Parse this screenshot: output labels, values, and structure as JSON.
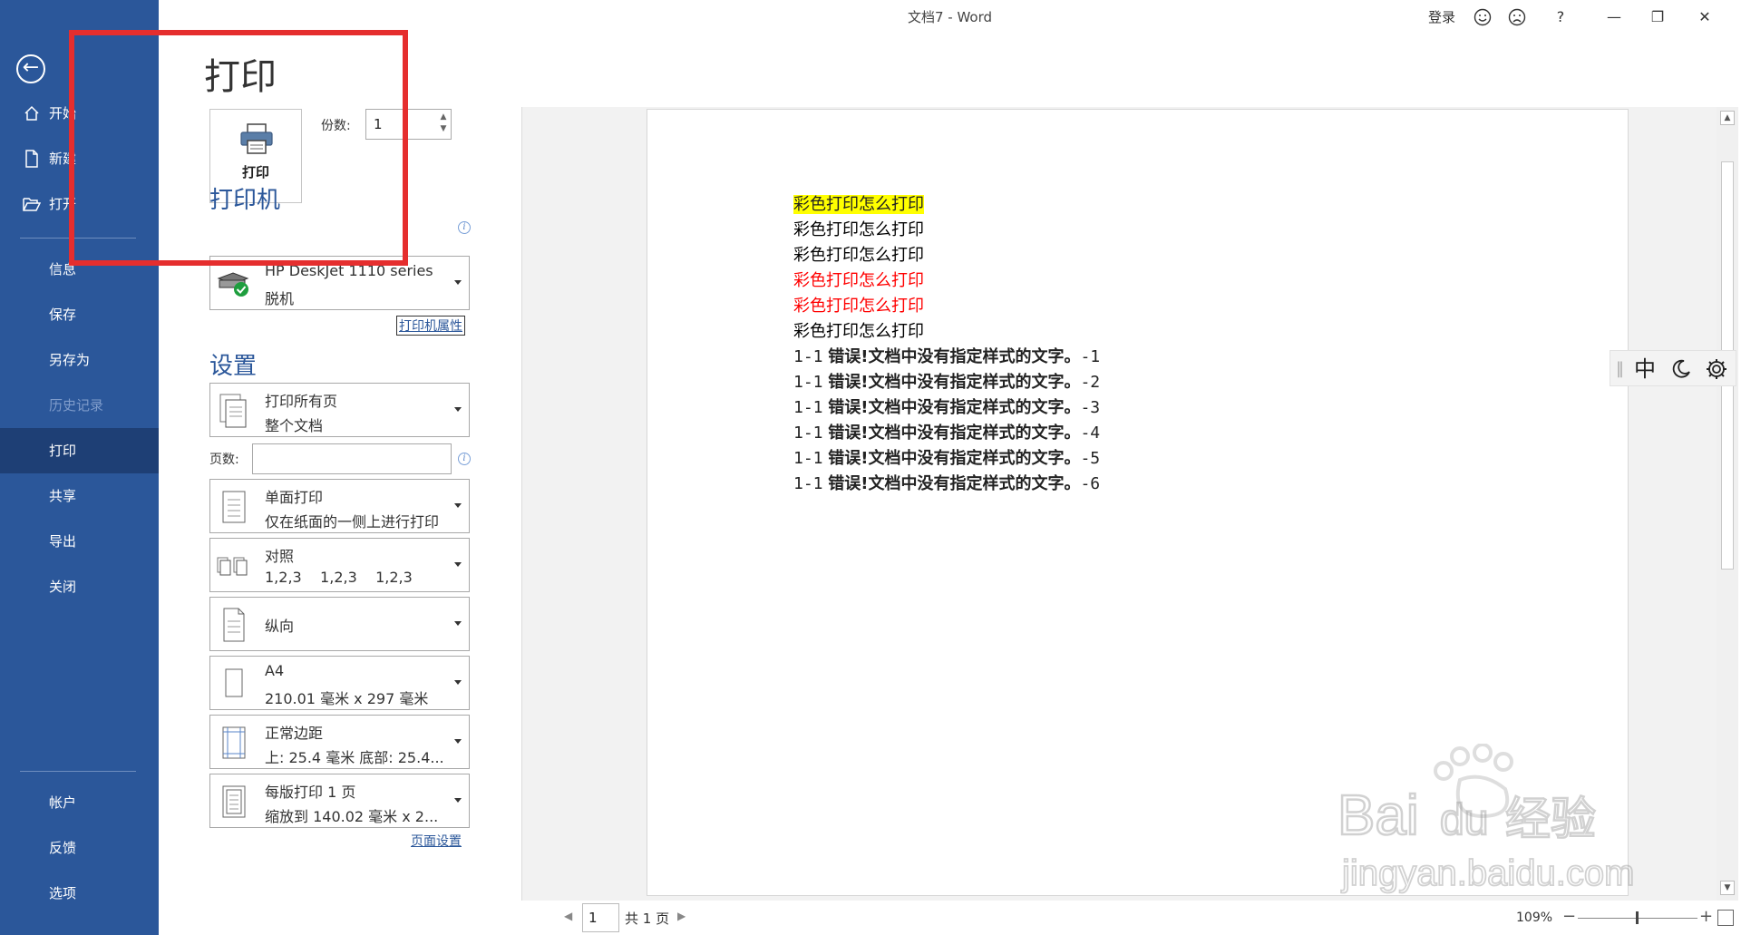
{
  "window": {
    "title": "文档7 - Word",
    "signin_label": "登录",
    "smile_icon": "smile-feedback-icon",
    "frown_icon": "frown-feedback-icon",
    "help_label": "?",
    "minimize": "—",
    "restore": "❐",
    "close": "✕"
  },
  "nav": {
    "back_icon": "←",
    "items": [
      {
        "label": "开始",
        "icon": "home-icon"
      },
      {
        "label": "新建",
        "icon": "new-document-icon"
      },
      {
        "label": "打开",
        "icon": "open-folder-icon"
      },
      {
        "label": "信息"
      },
      {
        "label": "保存"
      },
      {
        "label": "另存为"
      },
      {
        "label": "历史记录",
        "disabled": true
      },
      {
        "label": "打印",
        "active": true
      },
      {
        "label": "共享"
      },
      {
        "label": "导出"
      },
      {
        "label": "关闭"
      }
    ],
    "bottom_items": [
      {
        "label": "帐户"
      },
      {
        "label": "反馈"
      },
      {
        "label": "选项"
      }
    ]
  },
  "print": {
    "page_title": "打印",
    "print_button_label": "打印",
    "copies_label": "份数:",
    "copies_value": "1",
    "printer_section": "打印机",
    "printer_name": "HP DeskJet 1110 series",
    "printer_status": "脱机",
    "printer_properties_link": "打印机属性",
    "settings_section": "设置",
    "pages_label": "页数:",
    "pages_value": "",
    "page_setup_link": "页面设置",
    "settings": [
      {
        "line1": "打印所有页",
        "line2": "整个文档",
        "icon": "pages-icon"
      },
      {
        "line1": "单面打印",
        "line2": "仅在纸面的一侧上进行打印",
        "icon": "single-sided-icon"
      },
      {
        "line1": "对照",
        "line2": "1,2,3    1,2,3    1,2,3",
        "icon": "collate-icon"
      },
      {
        "line1": "纵向",
        "line2": "",
        "icon": "portrait-icon"
      },
      {
        "line1": "A4",
        "line2": "210.01 毫米 x 297 毫米",
        "icon": "paper-size-icon"
      },
      {
        "line1": "正常边距",
        "line2": "上: 25.4 毫米 底部: 25.4...",
        "icon": "margins-icon"
      },
      {
        "line1": "每版打印 1 页",
        "line2": "缩放到 140.02 毫米 x 2...",
        "icon": "pages-per-sheet-icon"
      }
    ]
  },
  "document": {
    "lines": [
      {
        "text": "彩色打印怎么打印",
        "color": "#000000",
        "highlight": "#ffff00"
      },
      {
        "text": "彩色打印怎么打印",
        "color": "#000000"
      },
      {
        "text": "彩色打印怎么打印",
        "color": "#000000"
      },
      {
        "text": "彩色打印怎么打印",
        "color": "#ff0000"
      },
      {
        "text": "彩色打印怎么打印",
        "color": "#ff0000"
      },
      {
        "text": "彩色打印怎么打印",
        "color": "#000000"
      }
    ],
    "errors": [
      {
        "num": "1-1",
        "text": "错误!文档中没有指定样式的文字。",
        "suffix": "-1"
      },
      {
        "num": "1-1",
        "text": "错误!文档中没有指定样式的文字。",
        "suffix": "-2"
      },
      {
        "num": "1-1",
        "text": "错误!文档中没有指定样式的文字。",
        "suffix": "-3"
      },
      {
        "num": "1-1",
        "text": "错误!文档中没有指定样式的文字。",
        "suffix": "-4"
      },
      {
        "num": "1-1",
        "text": "错误!文档中没有指定样式的文字。",
        "suffix": "-5"
      },
      {
        "num": "1-1",
        "text": "错误!文档中没有指定样式的文字。",
        "suffix": "-6"
      }
    ]
  },
  "ime": {
    "mode": "中",
    "moon_icon": "moon-icon",
    "gear_icon": "gear-icon"
  },
  "status": {
    "page_input": "1",
    "total_pages": "共 1 页",
    "zoom": "109%",
    "zoom_minus": "−",
    "zoom_plus": "+",
    "zoom_level_fraction": 0.5
  },
  "watermark": {
    "brand": "Bai du 经验",
    "url": "jingyan.baidu.com"
  },
  "colors": {
    "nav_blue": "#2b579a",
    "nav_active": "#1e3f75",
    "annotation_red": "#e52e2e"
  }
}
